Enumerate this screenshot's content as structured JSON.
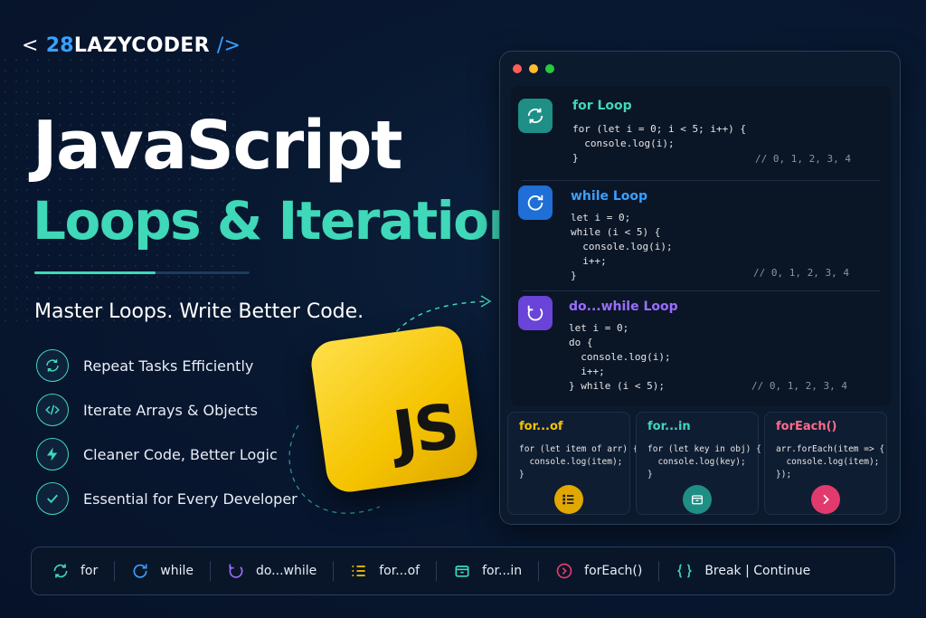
{
  "brand": {
    "prefix": "<",
    "number": "28",
    "name": "LAZYCODER",
    "suffix": "/>"
  },
  "headline": {
    "line1": "JavaScript",
    "line2": "Loops & Iteration"
  },
  "tagline": "Master Loops. Write Better Code.",
  "features": [
    {
      "icon": "refresh-icon",
      "text": "Repeat Tasks Efficiently"
    },
    {
      "icon": "code-icon",
      "text": "Iterate Arrays & Objects"
    },
    {
      "icon": "lightning-icon",
      "text": "Cleaner Code, Better Logic"
    },
    {
      "icon": "check-icon",
      "text": "Essential for Every Developer"
    }
  ],
  "badge": "JS",
  "code": {
    "for": {
      "title": "for Loop",
      "code": "for (let i = 0; i < 5; i++) {\n  console.log(i);\n}",
      "comment": "// 0, 1, 2, 3, 4"
    },
    "while": {
      "title": "while Loop",
      "code": "let i = 0;\nwhile (i < 5) {\n  console.log(i);\n  i++;\n}",
      "comment": "// 0, 1, 2, 3, 4"
    },
    "dowhile": {
      "title": "do...while Loop",
      "code": "let i = 0;\ndo {\n  console.log(i);\n  i++;\n} while (i < 5);",
      "comment": "// 0, 1, 2, 3, 4"
    }
  },
  "cards": {
    "forof": {
      "title": "for...of",
      "code": "for (let item of arr) {\n  console.log(item);\n}"
    },
    "forin": {
      "title": "for...in",
      "code": "for (let key in obj) {\n  console.log(key);\n}"
    },
    "foreach": {
      "title": "forEach()",
      "code": "arr.forEach(item => {\n  console.log(item);\n});"
    }
  },
  "bottom": {
    "for": "for",
    "while": "while",
    "dowhile": "do...while",
    "forof": "for...of",
    "forin": "for...in",
    "foreach": "forEach()",
    "breakcontinue": "Break | Continue"
  },
  "colors": {
    "accent": "#3fd8b8",
    "blue": "#3aa0ff",
    "purple": "#9b6dff",
    "yellow": "#f5c400",
    "pink": "#e23a6e"
  }
}
